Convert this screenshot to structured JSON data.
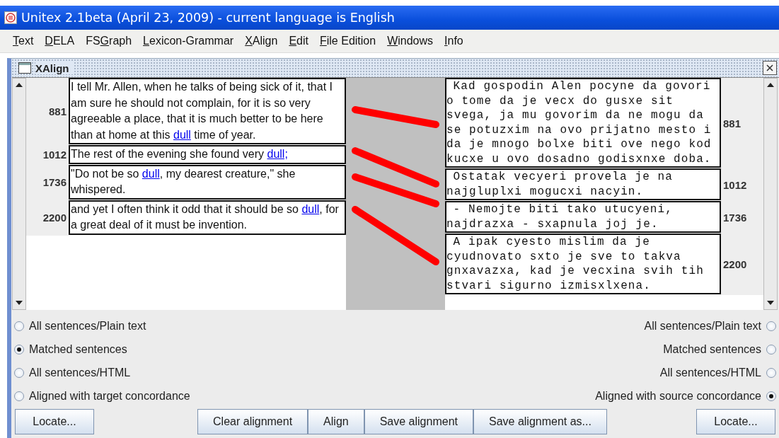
{
  "window": {
    "title": "Unitex 2.1beta (April 23, 2009) - current language is English"
  },
  "menu": [
    {
      "parts": [
        {
          "kind": "mnemonic",
          "text": "T"
        },
        {
          "kind": "plain",
          "text": "ext"
        }
      ]
    },
    {
      "parts": [
        {
          "kind": "mnemonic",
          "text": "D"
        },
        {
          "kind": "plain",
          "text": "ELA"
        }
      ]
    },
    {
      "parts": [
        {
          "kind": "plain",
          "text": "FS"
        },
        {
          "kind": "mnemonic",
          "text": "G"
        },
        {
          "kind": "plain",
          "text": "raph"
        }
      ]
    },
    {
      "parts": [
        {
          "kind": "mnemonic",
          "text": "L"
        },
        {
          "kind": "plain",
          "text": "exicon-Grammar"
        }
      ]
    },
    {
      "parts": [
        {
          "kind": "mnemonic",
          "text": "X"
        },
        {
          "kind": "plain",
          "text": "Align"
        }
      ]
    },
    {
      "parts": [
        {
          "kind": "mnemonic",
          "text": "E"
        },
        {
          "kind": "plain",
          "text": "dit"
        }
      ]
    },
    {
      "parts": [
        {
          "kind": "mnemonic",
          "text": "F"
        },
        {
          "kind": "plain",
          "text": "ile Edition"
        }
      ]
    },
    {
      "parts": [
        {
          "kind": "mnemonic",
          "text": "W"
        },
        {
          "kind": "plain",
          "text": "indows"
        }
      ]
    },
    {
      "parts": [
        {
          "kind": "mnemonic",
          "text": "I"
        },
        {
          "kind": "plain",
          "text": "nfo"
        }
      ]
    }
  ],
  "frame": {
    "title": "XAlign"
  },
  "source_rows": [
    {
      "number": "881",
      "segments": [
        {
          "kind": "plain",
          "text": "I tell Mr. Allen, when he talks of being sick of it, that I am sure he should not complain, for it is so very agreeable a place, that it is much better to be here than at home at this "
        },
        {
          "kind": "link",
          "text": "dull"
        },
        {
          "kind": "plain",
          "text": " time of year."
        }
      ]
    },
    {
      "number": "1012",
      "segments": [
        {
          "kind": "plain",
          "text": "The rest of the evening she found very "
        },
        {
          "kind": "link",
          "text": "dull;"
        }
      ]
    },
    {
      "number": "1736",
      "segments": [
        {
          "kind": "plain",
          "text": "\"Do not be so "
        },
        {
          "kind": "link",
          "text": "dull"
        },
        {
          "kind": "plain",
          "text": ", my dearest creature,\" she whispered."
        }
      ]
    },
    {
      "number": "2200",
      "segments": [
        {
          "kind": "plain",
          "text": "and yet I often think it odd that it should be so "
        },
        {
          "kind": "link",
          "text": "dull"
        },
        {
          "kind": "plain",
          "text": ", for a great deal of it must be invention."
        }
      ]
    }
  ],
  "target_rows": [
    {
      "number": "881",
      "text": "Kad gospodin Alen pocyne da govori o tome da je vecx do gusxe sit svega, ja mu govorim da ne mogu da se potuzxim na ovo prijatno mesto i da je mnogo bolxe biti ove nego kod kucxe u ovo dosadno godisxnxe doba."
    },
    {
      "number": "1012",
      "text": "Ostatak vecyeri provela je na najgluplxi mogucxi nacyin."
    },
    {
      "number": "1736",
      "text": "- Nemojte biti tako utucyeni, najdrazxa - sxapnula joj je."
    },
    {
      "number": "2200",
      "text": "A ipak cyesto mislim da je cyudnovato sxto je sve to takva gnxavazxa, kad je vecxina svih tih stvari sigurno izmisxlxena."
    }
  ],
  "source_options": [
    {
      "label": "All sentences/Plain text",
      "selected": false
    },
    {
      "label": "Matched sentences",
      "selected": true
    },
    {
      "label": "All sentences/HTML",
      "selected": false
    },
    {
      "label": "Aligned with target concordance",
      "selected": false
    }
  ],
  "target_options": [
    {
      "label": "All sentences/Plain text",
      "selected": false
    },
    {
      "label": "Matched sentences",
      "selected": false
    },
    {
      "label": "All sentences/HTML",
      "selected": false
    },
    {
      "label": "Aligned with source concordance",
      "selected": true
    }
  ],
  "buttons": {
    "left": "Locate...",
    "center": [
      "Clear alignment",
      "Align",
      "Save alignment",
      "Save alignment as..."
    ],
    "right": "Locate..."
  }
}
